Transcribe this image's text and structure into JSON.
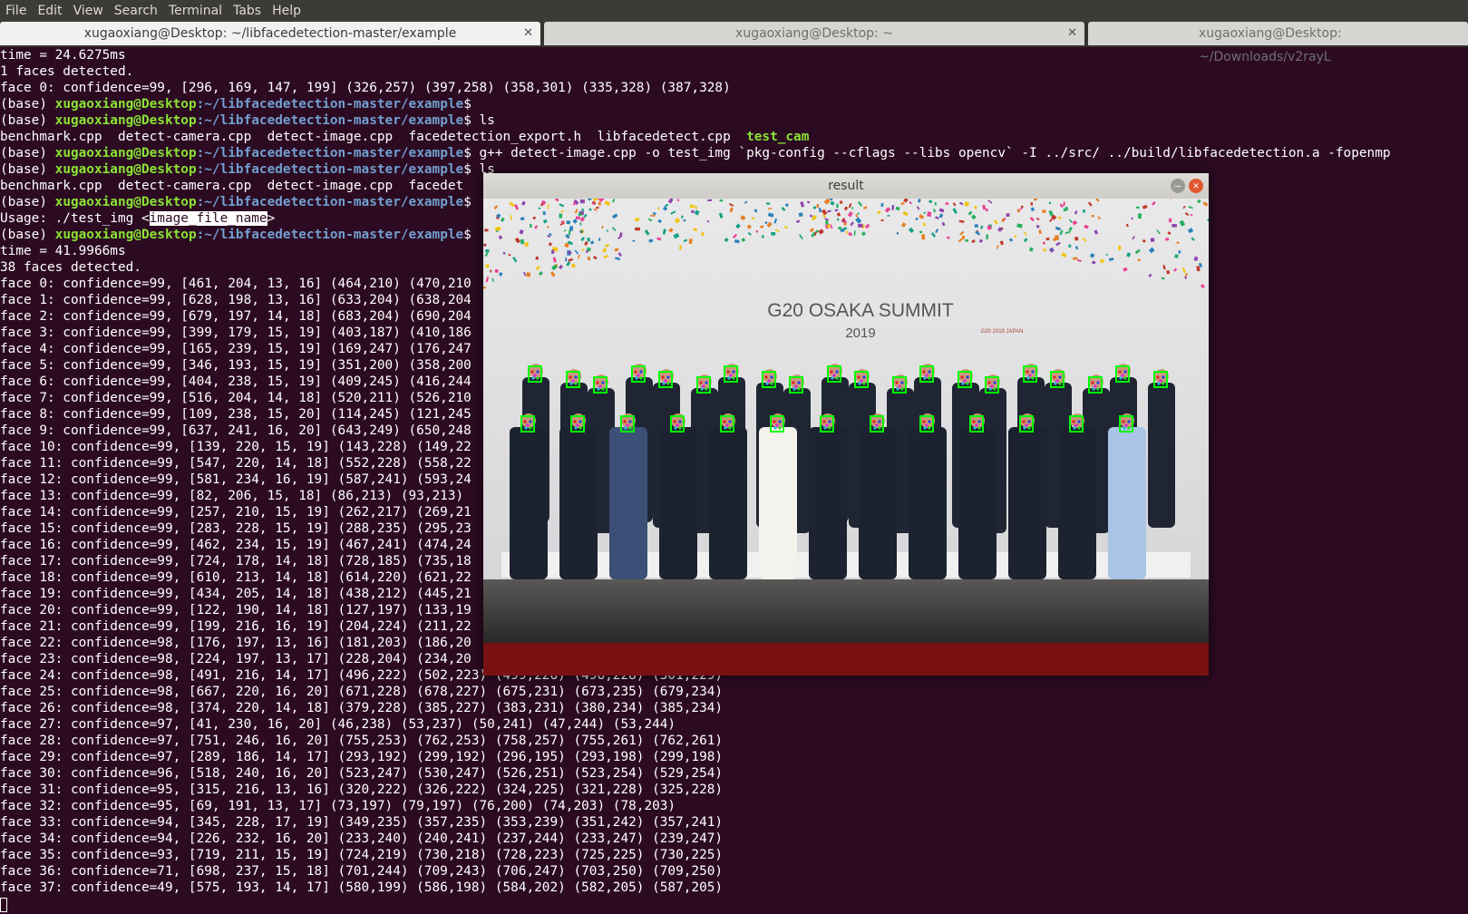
{
  "menubar": [
    "File",
    "Edit",
    "View",
    "Search",
    "Terminal",
    "Tabs",
    "Help"
  ],
  "tabs": [
    {
      "label": "xugaoxiang@Desktop: ~/libfacedetection-master/example",
      "active": true
    },
    {
      "label": "xugaoxiang@Desktop: ~",
      "active": false
    },
    {
      "label": "xugaoxiang@Desktop: ~/Downloads/v2rayL",
      "active": false
    }
  ],
  "prompt": {
    "base": "(base) ",
    "user": "xugaoxiang@Desktop",
    "path": ":~/libfacedetection-master/example",
    "end": "$ "
  },
  "terminal": {
    "l0": "time = 24.6275ms",
    "l1": "1 faces detected.",
    "l2": "face 0: confidence=99, [296, 169, 147, 199] (326,257) (397,258) (358,301) (335,328) (387,328)",
    "cmd_ls": "ls",
    "ls1": "benchmark.cpp  detect-camera.cpp  detect-image.cpp  facedetection_export.h  libfacedetect.cpp  ",
    "ls1_exec": "test_cam",
    "cmd_gpp": "g++ detect-image.cpp -o test_img `pkg-config --cflags --libs opencv` -I ../src/ ../build/libfacedetection.a -fopenmp",
    "cmd_ls2": "ls",
    "ls2": "benchmark.cpp  detect-camera.cpp  detect-image.cpp  facedet",
    "usage_a": "Usage: ./test_img <",
    "usage_sel": "image_file_name",
    "usage_b": ">",
    "time2": "time = 41.9966ms",
    "faces2": "38 faces detected.",
    "faces": [
      "face 0: confidence=99, [461, 204, 13, 16] (464,210) (470,210",
      "face 1: confidence=99, [628, 198, 13, 16] (633,204) (638,204",
      "face 2: confidence=99, [679, 197, 14, 18] (683,204) (690,204",
      "face 3: confidence=99, [399, 179, 15, 19] (403,187) (410,186",
      "face 4: confidence=99, [165, 239, 15, 19] (169,247) (176,247",
      "face 5: confidence=99, [346, 193, 15, 19] (351,200) (358,200",
      "face 6: confidence=99, [404, 238, 15, 19] (409,245) (416,244",
      "face 7: confidence=99, [516, 204, 14, 18] (520,211) (526,210",
      "face 8: confidence=99, [109, 238, 15, 20] (114,245) (121,245",
      "face 9: confidence=99, [637, 241, 16, 20] (643,249) (650,248",
      "face 10: confidence=99, [139, 220, 15, 19] (143,228) (149,22",
      "face 11: confidence=99, [547, 220, 14, 18] (552,228) (558,22",
      "face 12: confidence=99, [581, 234, 16, 19] (587,241) (593,24",
      "face 13: confidence=99, [82, 206, 15, 18] (86,213) (93,213)",
      "face 14: confidence=99, [257, 210, 15, 19] (262,217) (269,21",
      "face 15: confidence=99, [283, 228, 15, 19] (288,235) (295,23",
      "face 16: confidence=99, [462, 234, 15, 19] (467,241) (474,24",
      "face 17: confidence=99, [724, 178, 14, 18] (728,185) (735,18",
      "face 18: confidence=99, [610, 213, 14, 18] (614,220) (621,22",
      "face 19: confidence=99, [434, 205, 14, 18] (438,212) (445,21",
      "face 20: confidence=99, [122, 190, 14, 18] (127,197) (133,19",
      "face 21: confidence=99, [199, 216, 16, 19] (204,224) (211,22",
      "face 22: confidence=98, [176, 197, 13, 16] (181,203) (186,20",
      "face 23: confidence=98, [224, 197, 13, 17] (228,204) (234,20",
      "face 24: confidence=98, [491, 216, 14, 17] (496,222) (502,223) (499,226) (496,228) (501,229)",
      "face 25: confidence=98, [667, 220, 16, 20] (671,228) (678,227) (675,231) (673,235) (679,234)",
      "face 26: confidence=98, [374, 220, 14, 18] (379,228) (385,227) (383,231) (380,234) (385,234)",
      "face 27: confidence=97, [41, 230, 16, 20] (46,238) (53,237) (50,241) (47,244) (53,244)",
      "face 28: confidence=97, [751, 246, 16, 20] (755,253) (762,253) (758,257) (755,261) (762,261)",
      "face 29: confidence=97, [289, 186, 14, 17] (293,192) (299,192) (296,195) (293,198) (299,198)",
      "face 30: confidence=96, [518, 240, 16, 20] (523,247) (530,247) (526,251) (523,254) (529,254)",
      "face 31: confidence=95, [315, 216, 13, 16] (320,222) (326,222) (324,225) (321,228) (325,228)",
      "face 32: confidence=95, [69, 191, 13, 17] (73,197) (79,197) (76,200) (74,203) (78,203)",
      "face 33: confidence=94, [345, 228, 17, 19] (349,235) (357,235) (353,239) (351,242) (357,241)",
      "face 34: confidence=94, [226, 232, 16, 20] (233,240) (240,241) (237,244) (233,247) (239,247)",
      "face 35: confidence=93, [719, 211, 15, 19] (724,219) (730,218) (728,223) (725,225) (730,225)",
      "face 36: confidence=71, [698, 237, 15, 18] (701,244) (709,243) (706,247) (703,250) (709,250)",
      "face 37: confidence=49, [575, 193, 14, 17] (580,199) (586,198) (584,202) (582,205) (587,205)"
    ]
  },
  "window": {
    "title": "result",
    "banner_title": "G20 OSAKA SUMMIT",
    "banner_year": "2019",
    "logo_text": "G20 2019 JAPAN"
  },
  "colors": {
    "terminal_bg": "#2c0b22",
    "prompt_user": "#8ae234",
    "prompt_path": "#729fcf",
    "detect_box": "#00ff00"
  }
}
